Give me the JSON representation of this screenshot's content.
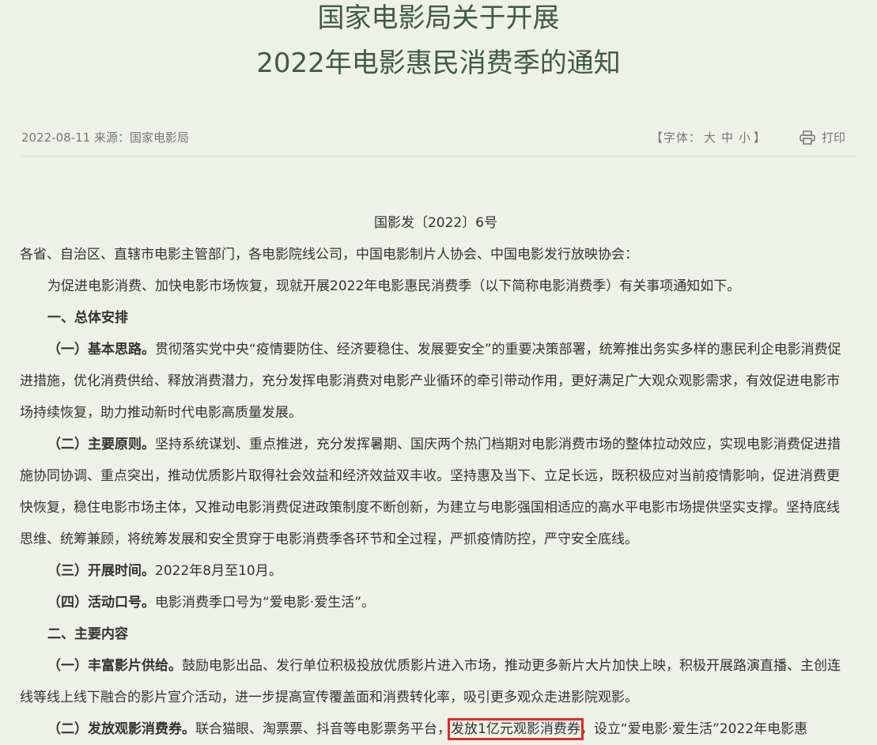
{
  "title": {
    "line1": "国家电影局关于开展",
    "line2": "2022年电影惠民消费季的通知"
  },
  "meta": {
    "date_source": "2022-08-11 来源：国家电影局",
    "font_open": "【字体：",
    "font_large": "大",
    "font_medium": "中",
    "font_small": "小",
    "font_close": "】",
    "print_icon": "printer-icon",
    "print_label": "打印"
  },
  "doc": {
    "number": "国影发〔2022〕6号",
    "addressee": "各省、自治区、直辖市电影主管部门，各电影院线公司，中国电影制片人协会、中国电影发行放映协会：",
    "intro": "为促进电影消费、加快电影市场恢复，现就开展2022年电影惠民消费季（以下简称电影消费季）有关事项通知如下。",
    "section1": "一、总体安排",
    "p1_kw": "（一）基本思路。",
    "p1_text": "贯彻落实党中央“疫情要防住、经济要稳住、发展要安全”的重要决策部署，统筹推出务实多样的惠民利企电影消费促进措施，优化消费供给、释放消费潜力，充分发挥电影消费对电影产业循环的牵引带动作用，更好满足广大观众观影需求，有效促进电影市场持续恢复，助力推动新时代电影高质量发展。",
    "p2_kw": "（二）主要原则。",
    "p2_text": "坚持系统谋划、重点推进，充分发挥暑期、国庆两个热门档期对电影消费市场的整体拉动效应，实现电影消费促进措施协同协调、重点突出，推动优质影片取得社会效益和经济效益双丰收。坚持惠及当下、立足长远，既积极应对当前疫情影响，促进消费更快恢复，稳住电影市场主体，又推动电影消费促进政策制度不断创新，为建立与电影强国相适应的高水平电影市场提供坚实支撑。坚持底线思维、统筹兼顾，将统筹发展和安全贯穿于电影消费季各环节和全过程，严抓疫情防控，严守安全底线。",
    "p3_kw": "（三）开展时间。",
    "p3_text": "2022年8月至10月。",
    "p4_kw": "（四）活动口号。",
    "p4_text": "电影消费季口号为“爱电影·爱生活”。",
    "section2": "二、主要内容",
    "p5_kw": "（一）丰富影片供给。",
    "p5_text": "鼓励电影出品、发行单位积极投放优质影片进入市场，推动更多新片大片加快上映，积极开展路演直播、主创连线等线上线下融合的影片宣介活动，进一步提高宣传覆盖面和消费转化率，吸引更多观众走进影院观影。",
    "p6_kw": "（二）发放观影消费券。",
    "p6_text_a": "联合猫眼、淘票票、抖音等电影票务平台，",
    "p6_highlight": "发放1亿元观影消费券",
    "p6_text_b": "，设立“爱电影·爱生活”2022年电影惠"
  }
}
